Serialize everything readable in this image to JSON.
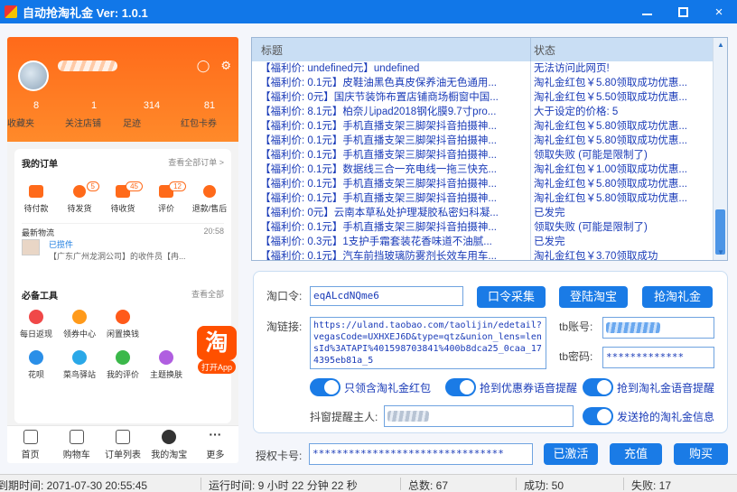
{
  "window": {
    "title": "自动抢淘礼金 Ver: 1.0.1",
    "minimize": "minimize",
    "maximize": "maximize",
    "close": "×"
  },
  "phone": {
    "stats": [
      {
        "num": "8",
        "label": "收藏夹"
      },
      {
        "num": "1",
        "label": "关注店铺"
      },
      {
        "num": "314",
        "label": "足迹"
      },
      {
        "num": "81",
        "label": "红包卡券"
      }
    ],
    "orders": {
      "title": "我的订单",
      "link": "查看全部订单 >",
      "items": [
        {
          "label": "待付款",
          "badge": ""
        },
        {
          "label": "待发货",
          "badge": "5"
        },
        {
          "label": "待收货",
          "badge": "45"
        },
        {
          "label": "评价",
          "badge": "12"
        },
        {
          "label": "退款/售后",
          "badge": ""
        }
      ],
      "logistics_title": "最新物流",
      "logistics_time": "20:58",
      "logistics_status": "已揽件",
      "logistics_msg": "【广东广州龙洞公司】的收件员【冉..."
    },
    "tools": {
      "title": "必备工具",
      "link": "查看全部",
      "items": [
        {
          "label": "每日返现",
          "color": "#f04848"
        },
        {
          "label": "领券中心",
          "color": "#ff9a1a"
        },
        {
          "label": "闲置换钱",
          "color": "#ff5a1a"
        },
        {
          "label": "",
          "color": "#ffffff"
        },
        {
          "label": "",
          "color": "#ffffff"
        },
        {
          "label": "花呗",
          "color": "#2a8fe8"
        },
        {
          "label": "菜鸟驿站",
          "color": "#2aa8e8"
        },
        {
          "label": "我的评价",
          "color": "#3bb84a"
        },
        {
          "label": "主题换肤",
          "color": "#b05ee0"
        }
      ]
    },
    "taobao_float": {
      "logo": "淘",
      "label": "打开App"
    },
    "tabbar": [
      "首页",
      "购物车",
      "订单列表",
      "我的淘宝",
      "更多"
    ]
  },
  "table": {
    "headers": [
      "标题",
      "状态"
    ],
    "rows": [
      {
        "title": "【福利价: undefined元】undefined",
        "status": "无法访问此网页!"
      },
      {
        "title": "【福利价: 0.1元】皮鞋油黑色真皮保养油无色通用...",
        "status": "淘礼金红包￥5.80领取成功优惠..."
      },
      {
        "title": "【福利价: 0元】国庆节装饰布置店铺商场橱窗中国...",
        "status": "淘礼金红包￥5.50领取成功优惠..."
      },
      {
        "title": "【福利价: 8.1元】柏奈儿ipad2018钢化膜9.7寸pro...",
        "status": "大于设定的价格: 5"
      },
      {
        "title": "【福利价: 0.1元】手机直播支架三脚架抖音拍摄神...",
        "status": "淘礼金红包￥5.80领取成功优惠..."
      },
      {
        "title": "【福利价: 0.1元】手机直播支架三脚架抖音拍摄神...",
        "status": "淘礼金红包￥5.80领取成功优惠..."
      },
      {
        "title": "【福利价: 0.1元】手机直播支架三脚架抖音拍摄神...",
        "status": "领取失败 (可能是限制了)"
      },
      {
        "title": "【福利价: 0.1元】数据线三合一充电线一拖三快充...",
        "status": "淘礼金红包￥1.00领取成功优惠..."
      },
      {
        "title": "【福利价: 0.1元】手机直播支架三脚架抖音拍摄神...",
        "status": "淘礼金红包￥5.80领取成功优惠..."
      },
      {
        "title": "【福利价: 0.1元】手机直播支架三脚架抖音拍摄神...",
        "status": "淘礼金红包￥5.80领取成功优惠..."
      },
      {
        "title": "【福利价: 0元】云南本草私处护理凝胶私密妇科凝...",
        "status": "已发完"
      },
      {
        "title": "【福利价: 0.1元】手机直播支架三脚架抖音拍摄神...",
        "status": "领取失败 (可能是限制了)"
      },
      {
        "title": "【福利价: 0.3元】1支护手霜套装花香味道不油腻...",
        "status": "已发完"
      },
      {
        "title": "【福利价: 0.1元】汽车前挡玻璃防雾剂长效车用车...",
        "status": "淘礼金红包￥3.70领取成功"
      }
    ]
  },
  "controls": {
    "kouling_label": "淘口令:",
    "kouling_value": "eqALcdNQme6",
    "btn_collect": "口令采集",
    "btn_login": "登陆淘宝",
    "btn_grab": "抢淘礼金",
    "link_label": "淘链接:",
    "link_value": "https://uland.taobao.com/taolijin/edetail?vegasCode=UXHXEJ6D&type=qtz&union_lens=lensId%3ATAPI%401598703841%400b8dca25_0caa_174395eb81a_5",
    "tb_account_label": "tb账号:",
    "tb_password_label": "tb密码:",
    "tb_password_value": "*************",
    "toggle_only_redpacket": "只领含淘礼金红包",
    "toggle_coupon_voice": "抢到优惠券语音提醒",
    "toggle_taolijin_voice": "抢到淘礼金语音提醒",
    "popup_owner_label": "抖窗提醒主人:",
    "toggle_send_info": "发送抢的淘礼金信息",
    "auth_label": "授权卡号:",
    "auth_value": "********************************",
    "btn_activated": "已激活",
    "btn_recharge": "充值",
    "btn_buy": "购买"
  },
  "status": {
    "expire": "到期时间:  2071-07-30 20:55:45",
    "runtime": "运行时间:  9 小时 22 分钟 22 秒",
    "total": "总数:  67",
    "success": "成功:  50",
    "fail": "失败:  17"
  }
}
